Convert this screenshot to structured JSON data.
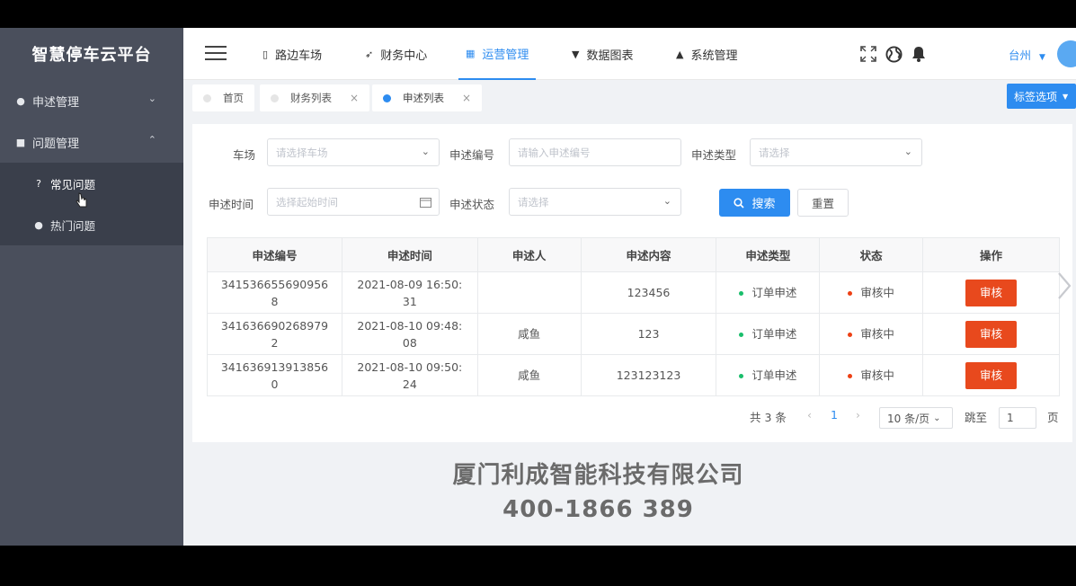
{
  "sidebar": {
    "brand": "智慧停车云平台",
    "menu": [
      {
        "label": "申述管理",
        "icon": "dot-icon",
        "chevron": "⌄"
      },
      {
        "label": "问题管理",
        "icon": "square-icon",
        "chevron": "⌃"
      }
    ],
    "submenu": [
      {
        "label": "常见问题",
        "icon": "question-icon"
      },
      {
        "label": "热门问题",
        "icon": "circle-icon"
      }
    ]
  },
  "header": {
    "nav": [
      {
        "label": "路边车场",
        "icon": "mobile-icon"
      },
      {
        "label": "财务中心",
        "icon": "send-icon"
      },
      {
        "label": "运营管理",
        "icon": "grid-icon"
      },
      {
        "label": "数据图表",
        "icon": "cart-icon"
      },
      {
        "label": "系统管理",
        "icon": "home-icon"
      }
    ],
    "active_nav": "运营管理",
    "city": "台州"
  },
  "tags": {
    "items": [
      {
        "label": "首页"
      },
      {
        "label": "财务列表",
        "close": "×"
      },
      {
        "label": "申述列表",
        "close": "×"
      }
    ],
    "options_label": "标签选项"
  },
  "filters": {
    "lot_label": "车场",
    "lot_placeholder": "请选择车场",
    "appeal_no_label": "申述编号",
    "appeal_no_placeholder": "请输入申述编号",
    "appeal_type_label": "申述类型",
    "appeal_type_placeholder": "请选择",
    "appeal_time_label": "申述时间",
    "appeal_time_placeholder": "选择起始时间",
    "appeal_status_label": "申述状态",
    "appeal_status_placeholder": "请选择",
    "search_label": "搜索",
    "reset_label": "重置"
  },
  "table": {
    "columns": [
      "申述编号",
      "申述时间",
      "申述人",
      "申述内容",
      "申述类型",
      "状态",
      "操作"
    ],
    "rows": [
      {
        "no_a": "341536655690956",
        "no_b": "8",
        "time_a": "2021-08-09 16:50:",
        "time_b": "31",
        "person": "",
        "content": "123456",
        "type": "订单申述",
        "status": "审核中",
        "action": "审核"
      },
      {
        "no_a": "341636690268979",
        "no_b": "2",
        "time_a": "2021-08-10 09:48:",
        "time_b": "08",
        "person": "咸鱼",
        "content": "123",
        "type": "订单申述",
        "status": "审核中",
        "action": "审核"
      },
      {
        "no_a": "341636913913856",
        "no_b": "0",
        "time_a": "2021-08-10 09:50:",
        "time_b": "24",
        "person": "咸鱼",
        "content": "123123123",
        "type": "订单申述",
        "status": "审核中",
        "action": "审核"
      }
    ]
  },
  "pagination": {
    "total": "共 3 条",
    "prev": "‹",
    "current": "1",
    "next": "›",
    "page_size": "10 条/页",
    "goto_label": "跳至",
    "goto_value": "1",
    "page_suffix": "页"
  },
  "watermark": {
    "company": "厦门利成智能科技有限公司",
    "phone": "400-1866 389"
  },
  "colors": {
    "accent": "#2d8cf0",
    "danger": "#e8491d",
    "type_dot": "#19be6b",
    "status_dot": "#ed4014"
  }
}
